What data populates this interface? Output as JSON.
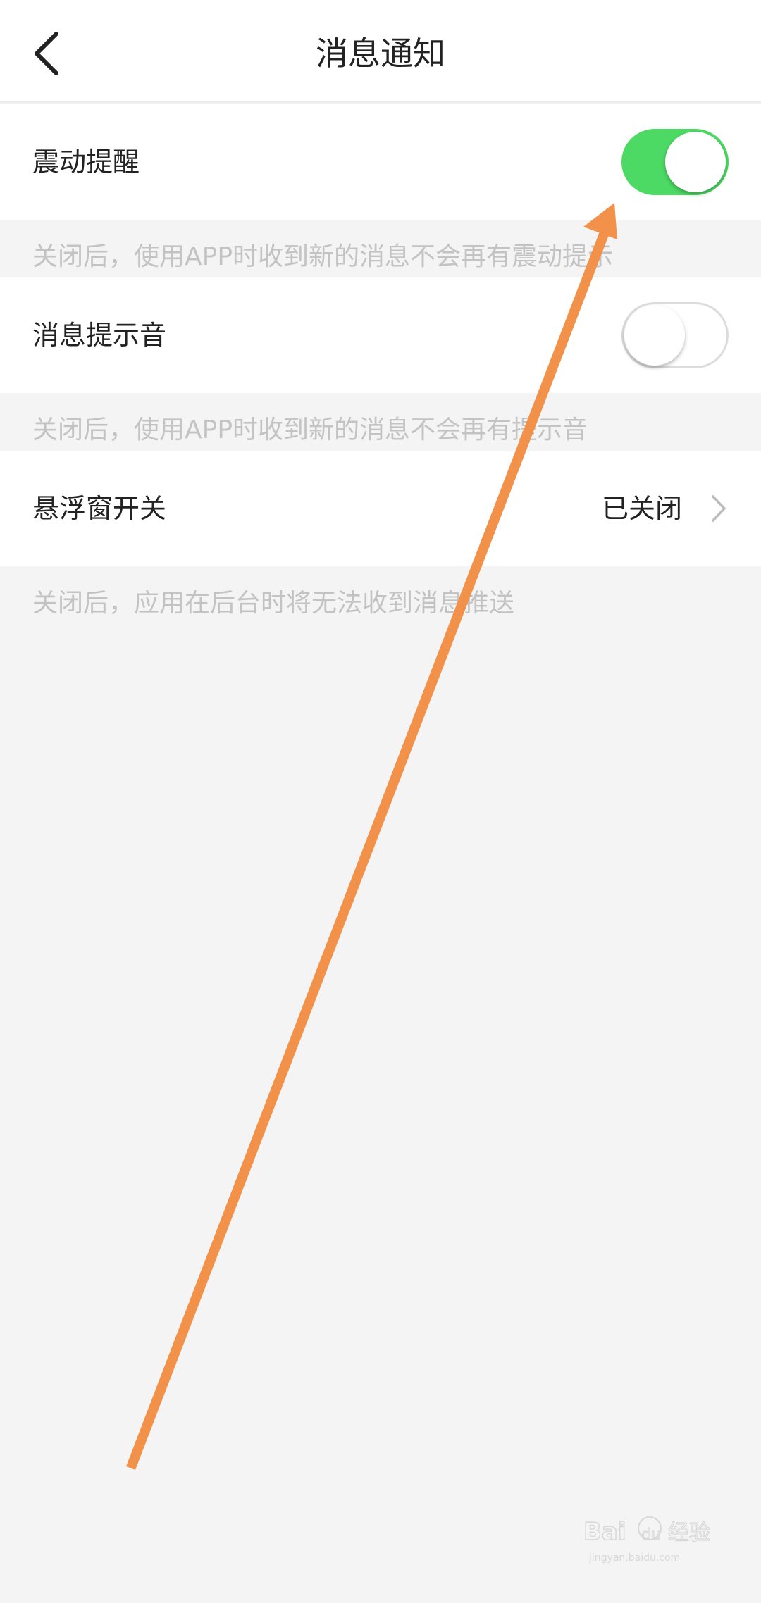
{
  "header": {
    "title": "消息通知",
    "back_icon": "chevron-left-icon"
  },
  "settings": [
    {
      "label": "震动提醒",
      "control": "toggle",
      "enabled": true,
      "hint": "关闭后，使用APP时收到新的消息不会再有震动提示"
    },
    {
      "label": "消息提示音",
      "control": "toggle",
      "enabled": false,
      "hint": "关闭后，使用APP时收到新的消息不会再有提示音"
    },
    {
      "label": "悬浮窗开关",
      "control": "link",
      "value": "已关闭",
      "hint": "关闭后，应用在后台时将无法收到消息推送"
    }
  ],
  "colors": {
    "toggle_on": "#4cd964",
    "annotation_arrow": "#f2914a",
    "hint_text": "#c3c3c3"
  },
  "annotation": {
    "type": "arrow",
    "points_to": "vibration-toggle"
  },
  "watermark": {
    "text": "Baidu经验",
    "sub": "jingyan.baidu.com"
  }
}
